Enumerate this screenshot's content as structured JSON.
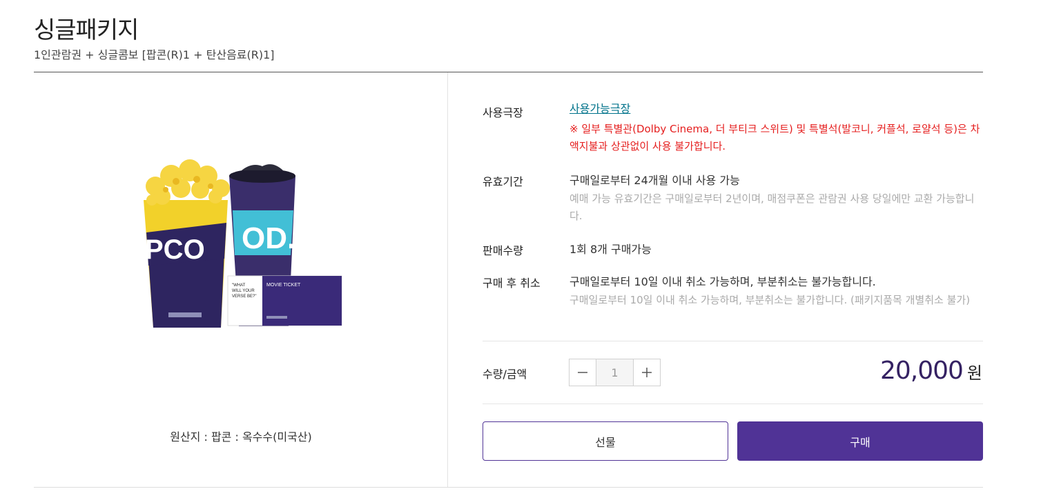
{
  "product": {
    "title": "싱글패키지",
    "subtitle": "1인관람권 + 싱글콤보 [팝콘(R)1 + 탄산음료(R)1]",
    "image_alt": "popcorn-drink-ticket-image",
    "origin": "원산지 : 팝콘 : 옥수수(미국산)"
  },
  "info": {
    "theater": {
      "label": "사용극장",
      "link": "사용가능극장",
      "notice": "※ 일부 특별관(Dolby Cinema, 더 부티크 스위트) 및 특별석(발코니, 커플석, 로얄석 등)은 차액지불과 상관없이 사용 불가합니다."
    },
    "validity": {
      "label": "유효기간",
      "value": "구매일로부터 24개월 이내 사용 가능",
      "note": "예매 가능 유효기간은 구매일로부터 2년이며, 매점쿠폰은 관람권 사용 당일에만 교환 가능합니다."
    },
    "sale_qty": {
      "label": "판매수량",
      "value": "1회 8개 구매가능"
    },
    "cancel": {
      "label": "구매 후 취소",
      "value": "구매일로부터 10일 이내 취소 가능하며, 부분취소는 불가능합니다.",
      "note": "구매일로부터 10일 이내 취소 가능하며, 부분취소는 불가합니다. (패키지품목 개별취소 불가)"
    }
  },
  "purchase": {
    "qty_label": "수량/금액",
    "quantity": "1",
    "price": "20,000",
    "currency": "원",
    "gift_label": "선물",
    "buy_label": "구매"
  },
  "colors": {
    "brand_purple": "#503396",
    "price_color": "#352263",
    "link_teal": "#01738b",
    "warning_red": "#e51e1e"
  }
}
